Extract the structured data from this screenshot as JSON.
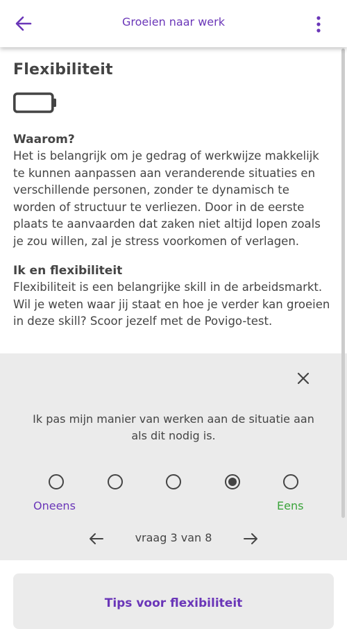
{
  "colors": {
    "accent": "#6a36b8",
    "agree": "#3aa33a",
    "text": "#444444",
    "panel_background": "#ebebeb"
  },
  "app_bar": {
    "title": "Groeien naar werk",
    "back_icon": "arrow-left-icon",
    "menu_icon": "more-vertical-icon"
  },
  "page": {
    "title": "Flexibiliteit",
    "level_icon": "empty-battery-icon"
  },
  "sections": [
    {
      "title": "Waarom?",
      "text": "Het is belangrijk om je gedrag of werkwijze makkelijk te kunnen aanpassen aan veranderende situaties en verschillende personen, zonder te dynamisch te worden of structuur te verliezen. Door in de eerste plaats te aanvaarden dat zaken niet altijd lopen zoals je zou willen, zal je stress voorkomen of verlagen."
    },
    {
      "title": "Ik en flexibiliteit",
      "text": "Flexibiliteit is een belangrijke skill in de arbeidsmarkt. Wil je weten waar jij staat en hoe je verder kan groeien in deze skill? Scoor jezelf met de Povigo-test."
    }
  ],
  "rating": {
    "close_icon": "close-icon",
    "question": "Ik pas mijn manier van werken aan de situatie aan als dit nodig is.",
    "option_count": 5,
    "selected_option": 4,
    "label_left": "Oneens",
    "label_right": "Eens",
    "counter": "vraag 3 van 8",
    "prev_icon": "arrow-left-icon",
    "next_icon": "arrow-right-icon"
  },
  "tips": {
    "label": "Tips voor flexibiliteit"
  }
}
